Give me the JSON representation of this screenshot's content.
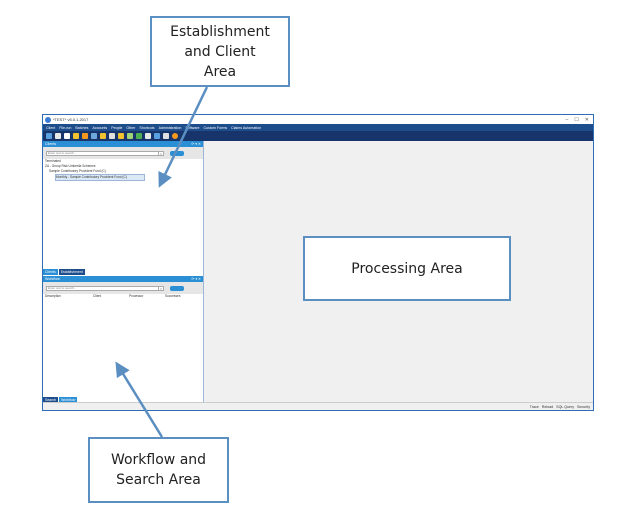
{
  "callouts": {
    "top": "Establishment\nand Client\nArea",
    "processing": "Processing Area",
    "bottom": "Workflow and\nSearch Area"
  },
  "window": {
    "title": "*TEST* v5.0.1.2017"
  },
  "menu": [
    "Client",
    "File-run",
    "Batches",
    "Accounts",
    "People",
    "Other",
    "Shortcuts",
    "Administration",
    "Software",
    "Custom Forms",
    "Claims Automation"
  ],
  "clients_panel": {
    "title": "Clients",
    "search_placeholder": "Enter text to search...",
    "tree": [
      "Terminated",
      "ZA - Group Risk Umbrella Schemes",
      "Sample Contributory Provident Fund (C)",
      "Monthly - Sample Contributory Provident Fund (C)"
    ]
  },
  "tabs_top": [
    "Clients",
    "Establishment"
  ],
  "workflow_panel": {
    "title": "Workflow",
    "search_placeholder": "Enter text to search...",
    "columns": [
      "Description",
      "Client",
      "Processor",
      "Successes"
    ]
  },
  "tabs_bottom": [
    "Search",
    "Workflow"
  ],
  "status": [
    "Trace",
    "Reload",
    "SQL Query",
    "Security"
  ],
  "colors": {
    "accent": "#2a8fd4",
    "menubar": "#1e4d8c",
    "callout_border": "#5b8ec1"
  }
}
